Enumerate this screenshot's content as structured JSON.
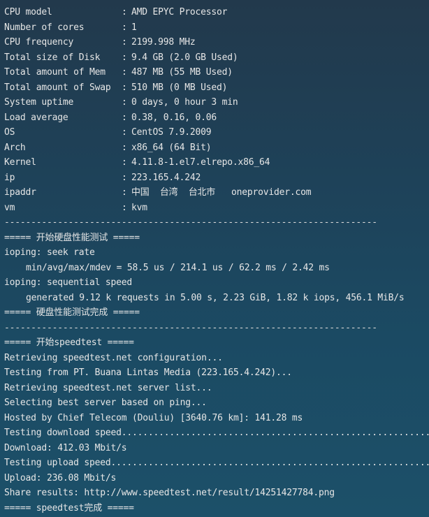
{
  "window": {
    "title": ""
  },
  "sysinfo": [
    {
      "key": "CPU model",
      "value": "AMD EPYC Processor"
    },
    {
      "key": "Number of cores",
      "value": "1"
    },
    {
      "key": "CPU frequency",
      "value": "2199.998 MHz"
    },
    {
      "key": "Total size of Disk",
      "value": "9.4 GB (2.0 GB Used)"
    },
    {
      "key": "Total amount of Mem",
      "value": "487 MB (55 MB Used)"
    },
    {
      "key": "Total amount of Swap",
      "value": "510 MB (0 MB Used)"
    },
    {
      "key": "System uptime",
      "value": "0 days, 0 hour 3 min"
    },
    {
      "key": "Load average",
      "value": "0.38, 0.16, 0.06"
    },
    {
      "key": "OS",
      "value": "CentOS 7.9.2009"
    },
    {
      "key": "Arch",
      "value": "x86_64 (64 Bit)"
    },
    {
      "key": "Kernel",
      "value": "4.11.8-1.el7.elrepo.x86_64"
    },
    {
      "key": "ip",
      "value": "223.165.4.242"
    },
    {
      "key": "ipaddr",
      "value": "中国  台湾  台北市   oneprovider.com"
    },
    {
      "key": "vm",
      "value": "kvm"
    }
  ],
  "separator": ":",
  "rule": "----------------------------------------------------------------------",
  "disk_test": {
    "start": "===== 开始硬盘性能测试 =====",
    "seek_rate_label": "ioping: seek rate",
    "seek_rate_value": "min/avg/max/mdev = 58.5 us / 214.1 us / 62.2 ms / 2.42 ms",
    "seq_speed_label": "ioping: sequential speed",
    "seq_speed_value": "generated 9.12 k requests in 5.00 s, 2.23 GiB, 1.82 k iops, 456.1 MiB/s",
    "end": "===== 硬盘性能测试完成 ====="
  },
  "speedtest": {
    "start": "===== 开始speedtest =====",
    "lines": [
      "Retrieving speedtest.net configuration...",
      "Testing from PT. Buana Lintas Media (223.165.4.242)...",
      "Retrieving speedtest.net server list...",
      "Selecting best server based on ping...",
      "Hosted by Chief Telecom (Douliu) [3640.76 km]: 141.28 ms",
      "Testing download speed.................................................................................",
      "Download: 412.03 Mbit/s",
      "Testing upload speed.................................................................................",
      "Upload: 236.08 Mbit/s",
      "Share results: http://www.speedtest.net/result/14251427784.png"
    ],
    "end": "===== speedtest完成 ====="
  }
}
